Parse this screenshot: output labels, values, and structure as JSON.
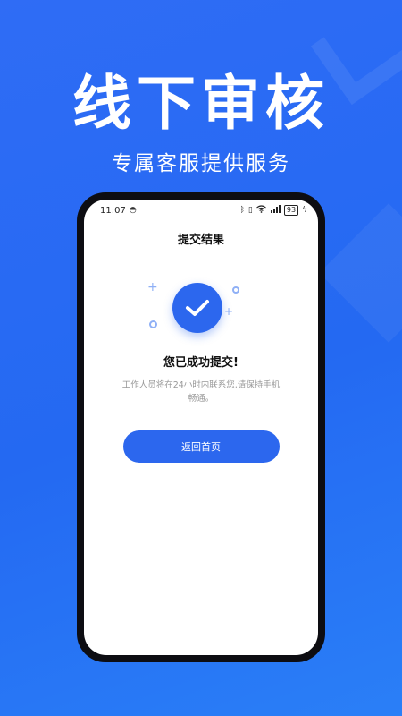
{
  "hero": {
    "title": "线下审核",
    "subtitle": "专属客服提供服务"
  },
  "status_bar": {
    "time": "11:07",
    "battery": "93",
    "icons": [
      "app-notification-icon",
      "bluetooth-icon",
      "vibrate-icon",
      "wifi-icon",
      "signal-4g-icon",
      "battery-icon",
      "charging-icon"
    ]
  },
  "page": {
    "title": "提交结果",
    "success_title": "您已成功提交!",
    "success_desc": "工作人员将在24小时内联系您,请保持手机畅通。",
    "home_button": "返回首页"
  },
  "colors": {
    "background": "#2469f2",
    "accent": "#2c67ee",
    "decoration": "#8fb0f6"
  }
}
